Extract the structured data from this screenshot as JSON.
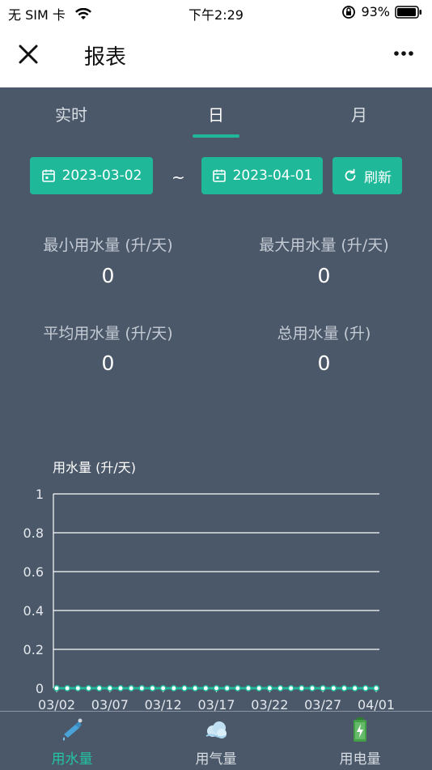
{
  "status_bar": {
    "carrier": "无 SIM 卡",
    "time": "下午2:29",
    "battery": "93%"
  },
  "nav": {
    "title": "报表"
  },
  "tabs": [
    {
      "label": "实时",
      "active": false
    },
    {
      "label": "日",
      "active": true
    },
    {
      "label": "月",
      "active": false
    }
  ],
  "date_range": {
    "start": "2023-03-02",
    "separator": "~",
    "end": "2023-04-01",
    "refresh_label": "刷新"
  },
  "stats": [
    {
      "label": "最小用水量 (升/天)",
      "value": "0"
    },
    {
      "label": "最大用水量 (升/天)",
      "value": "0"
    },
    {
      "label": "平均用水量 (升/天)",
      "value": "0"
    },
    {
      "label": "总用水量 (升)",
      "value": "0"
    }
  ],
  "chart_data": {
    "type": "line",
    "ylabel": "用水量 (升/天)",
    "ylim": [
      0,
      1
    ],
    "yticks": [
      "0",
      "0.2",
      "0.4",
      "0.6",
      "0.8",
      "1"
    ],
    "xtick_labels": [
      "03/02",
      "03/07",
      "03/12",
      "03/17",
      "03/22",
      "03/27",
      "04/01"
    ],
    "x": [
      "03/02",
      "03/03",
      "03/04",
      "03/05",
      "03/06",
      "03/07",
      "03/08",
      "03/09",
      "03/10",
      "03/11",
      "03/12",
      "03/13",
      "03/14",
      "03/15",
      "03/16",
      "03/17",
      "03/18",
      "03/19",
      "03/20",
      "03/21",
      "03/22",
      "03/23",
      "03/24",
      "03/25",
      "03/26",
      "03/27",
      "03/28",
      "03/29",
      "03/30",
      "03/31",
      "04/01"
    ],
    "series": [
      {
        "values": [
          0,
          0,
          0,
          0,
          0,
          0,
          0,
          0,
          0,
          0,
          0,
          0,
          0,
          0,
          0,
          0,
          0,
          0,
          0,
          0,
          0,
          0,
          0,
          0,
          0,
          0,
          0,
          0,
          0,
          0,
          0
        ]
      }
    ],
    "grid": true,
    "line_color": "#1fb99a"
  },
  "tabbar": [
    {
      "label": "用水量",
      "icon": "water-tap-icon",
      "active": true
    },
    {
      "label": "用气量",
      "icon": "gas-cloud-icon",
      "active": false
    },
    {
      "label": "用电量",
      "icon": "battery-icon",
      "active": false
    }
  ]
}
